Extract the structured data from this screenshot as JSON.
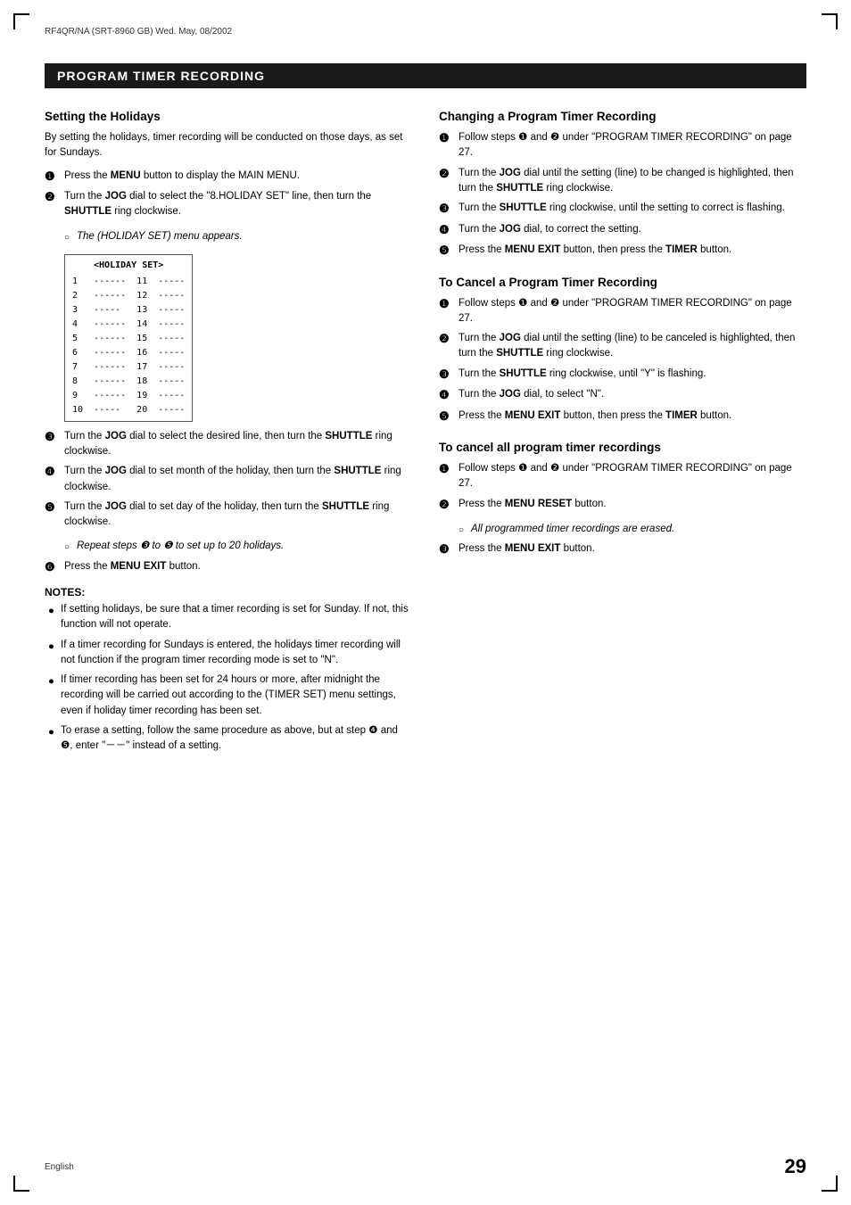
{
  "header": {
    "text": "RF4QR/NA (SRT-8960 GB)   Wed. May, 08/2002"
  },
  "title_bar": "PROGRAM TIMER RECORDING",
  "left_column": {
    "section1": {
      "title": "Setting the Holidays",
      "intro": "By setting the holidays, timer recording will be conducted on those days, as set for Sundays.",
      "steps": [
        {
          "num": "❶",
          "text": "Press the ",
          "bold": "MENU",
          "text2": " button to display the MAIN MENU."
        },
        {
          "num": "❷",
          "text": "Turn the ",
          "bold": "JOG",
          "text2": " dial to select the \"8.HOLIDAY SET\" line, then turn the ",
          "bold2": "SHUTTLE",
          "text3": " ring clockwise."
        }
      ],
      "holiday_set_sub": "The (HOLIDAY SET) menu appears.",
      "holiday_table_title": "<HOLIDAY SET>",
      "holiday_rows": [
        {
          "left_num": "1",
          "left_val": "------",
          "right_num": "11",
          "right_val": "-----"
        },
        {
          "left_num": "2",
          "left_val": "------",
          "right_num": "12",
          "right_val": "-----"
        },
        {
          "left_num": "3",
          "left_val": "-----",
          "right_num": "13",
          "right_val": "-----"
        },
        {
          "left_num": "4",
          "left_val": "------",
          "right_num": "14",
          "right_val": "-----"
        },
        {
          "left_num": "5",
          "left_val": "------",
          "right_num": "15",
          "right_val": "-----"
        },
        {
          "left_num": "6",
          "left_val": "------",
          "right_num": "16",
          "right_val": "-----"
        },
        {
          "left_num": "7",
          "left_val": "------",
          "right_num": "17",
          "right_val": "-----"
        },
        {
          "left_num": "8",
          "left_val": "------",
          "right_num": "18",
          "right_val": "-----"
        },
        {
          "left_num": "9",
          "left_val": "------",
          "right_num": "19",
          "right_val": "-----"
        },
        {
          "left_num": "10",
          "left_val": "-----",
          "right_num": "20",
          "right_val": "-----"
        }
      ],
      "steps2": [
        {
          "num": "❸",
          "text": "Turn the ",
          "bold": "JOG",
          "text2": " dial to select the desired line, then turn the ",
          "bold2": "SHUTTLE",
          "text3": " ring clockwise."
        },
        {
          "num": "❹",
          "text": "Turn the ",
          "bold": "JOG",
          "text2": " dial to set month of the holiday, then turn the ",
          "bold2": "SHUTTLE",
          "text3": " ring clockwise."
        },
        {
          "num": "❺",
          "text": "Turn the ",
          "bold": "JOG",
          "text2": " dial to set day of the holiday, then turn the ",
          "bold2": "SHUTTLE",
          "text3": " ring clockwise."
        }
      ],
      "repeat_note": "Repeat steps ❸ to ❺ to set up to 20 holidays.",
      "step6": {
        "num": "❻",
        "text": "Press the ",
        "bold": "MENU EXIT",
        "text2": " button."
      },
      "notes_title": "NOTES:",
      "notes": [
        "If setting holidays, be sure that a timer recording is set for Sunday. If not, this function will not operate.",
        "If a timer recording for Sundays is entered, the holidays timer recording will not function if the program timer recording mode is set to \"N\".",
        "If timer recording has been set for 24 hours or more, after midnight the recording will be carried out according to the (TIMER SET) menu settings, even if holiday timer recording has been set.",
        "To erase a setting, follow the same procedure as above, but at step ❹ and ❺, enter \"－－\" instead of a setting."
      ]
    }
  },
  "right_column": {
    "section1": {
      "title": "Changing a Program Timer Recording",
      "steps": [
        {
          "num": "❶",
          "text": "Follow steps ❶ and ❷ under \"PROGRAM TIMER RECORDING\" on page 27."
        },
        {
          "num": "❷",
          "text": "Turn the ",
          "bold": "JOG",
          "text2": " dial until the setting (line) to be changed is highlighted, then turn the ",
          "bold2": "SHUTTLE",
          "text3": " ring clockwise."
        },
        {
          "num": "❸",
          "text": "Turn the ",
          "bold": "SHUTTLE",
          "text2": " ring clockwise, until the setting to correct is flashing."
        },
        {
          "num": "❹",
          "text": "Turn the ",
          "bold": "JOG",
          "text2": " dial, to correct the setting."
        },
        {
          "num": "❺",
          "text": "Press the ",
          "bold": "MENU EXIT",
          "text2": " button, then press the ",
          "bold2": "TIMER",
          "text3": " button."
        }
      ]
    },
    "section2": {
      "title": "To Cancel a Program Timer Recording",
      "steps": [
        {
          "num": "❶",
          "text": "Follow steps ❶ and ❷ under \"PROGRAM TIMER RECORDING\" on page 27."
        },
        {
          "num": "❷",
          "text": "Turn the ",
          "bold": "JOG",
          "text2": " dial until the setting (line) to be canceled is highlighted, then turn the ",
          "bold2": "SHUTTLE",
          "text3": " ring clockwise."
        },
        {
          "num": "❸",
          "text": "Turn the ",
          "bold": "SHUTTLE",
          "text2": " ring clockwise, until \"Y\" is flashing."
        },
        {
          "num": "❹",
          "text": "Turn the ",
          "bold": "JOG",
          "text2": " dial, to select \"N\"."
        },
        {
          "num": "❺",
          "text": "Press the ",
          "bold": "MENU EXIT",
          "text2": " button, then press the ",
          "bold2": "TIMER",
          "text3": " button."
        }
      ]
    },
    "section3": {
      "title": "To cancel all program timer recordings",
      "steps": [
        {
          "num": "❶",
          "text": "Follow steps ❶ and ❷ under \"PROGRAM TIMER RECORDING\" on page 27."
        },
        {
          "num": "❷",
          "text": "Press the ",
          "bold": "MENU RESET",
          "text2": " button."
        }
      ],
      "sub_note": "All programmed timer recordings are erased.",
      "step3": {
        "num": "❸",
        "text": "Press the ",
        "bold": "MENU EXIT",
        "text2": " button."
      }
    }
  },
  "footer": {
    "language": "English",
    "page_number": "29"
  }
}
